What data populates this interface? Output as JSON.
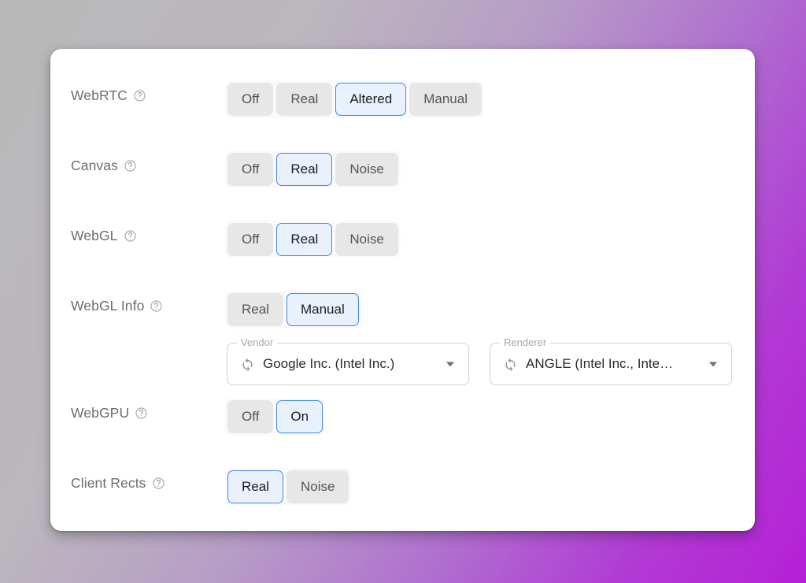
{
  "theme": {
    "card_background": "#ffffff",
    "selected_border": "#4187f0",
    "selected_background": "#e9f1fd",
    "unselected_background": "#e7e7e7",
    "label_color": "#6d6d6d",
    "page_gradient_from": "#b8b8b8",
    "page_gradient_to": "#b520d6"
  },
  "icons": {
    "help": "help-circle-icon",
    "sync": "sync-icon",
    "caret": "caret-down-icon"
  },
  "settings": [
    {
      "id": "webrtc",
      "label": "WebRTC",
      "help": "?",
      "options": [
        "Off",
        "Real",
        "Altered",
        "Manual"
      ],
      "selected": "Altered"
    },
    {
      "id": "canvas",
      "label": "Canvas",
      "help": "?",
      "options": [
        "Off",
        "Real",
        "Noise"
      ],
      "selected": "Real"
    },
    {
      "id": "webgl",
      "label": "WebGL",
      "help": "?",
      "options": [
        "Off",
        "Real",
        "Noise"
      ],
      "selected": "Real"
    },
    {
      "id": "webgl-info",
      "label": "WebGL Info",
      "help": "?",
      "options": [
        "Real",
        "Manual"
      ],
      "selected": "Manual",
      "dropdowns": [
        {
          "id": "vendor",
          "legend": "Vendor",
          "value": "Google Inc. (Intel Inc.)"
        },
        {
          "id": "renderer",
          "legend": "Renderer",
          "value": "ANGLE (Intel Inc., Inte…"
        }
      ]
    },
    {
      "id": "webgpu",
      "label": "WebGPU",
      "help": "?",
      "options": [
        "Off",
        "On"
      ],
      "selected": "On"
    },
    {
      "id": "client-rects",
      "label": "Client Rects",
      "help": "?",
      "options": [
        "Real",
        "Noise"
      ],
      "selected": "Real"
    }
  ]
}
